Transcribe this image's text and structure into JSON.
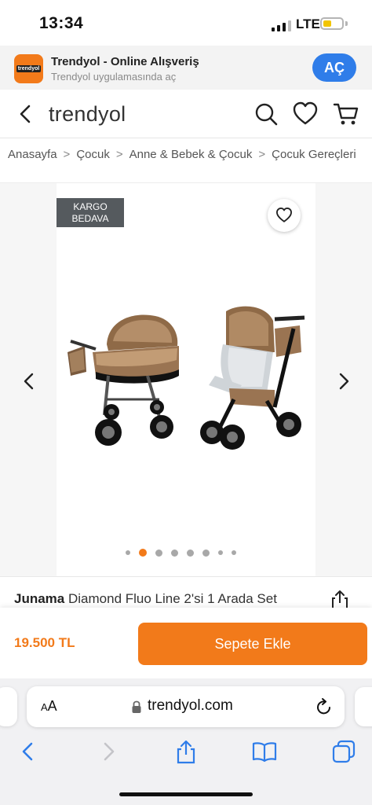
{
  "status_bar": {
    "time": "13:34",
    "network": "LTE"
  },
  "app_banner": {
    "logo_text": "trendyol",
    "title": "Trendyol - Online Alışveriş",
    "subtitle": "Trendyol uygulamasında aç",
    "open_label": "AÇ"
  },
  "header": {
    "brand": "trendyol",
    "icons": [
      "back-icon",
      "search-icon",
      "heart-icon",
      "cart-icon"
    ]
  },
  "breadcrumb": [
    "Anasayfa",
    "Çocuk",
    "Anne & Bebek & Çocuk",
    "Çocuk Gereçleri"
  ],
  "gallery": {
    "badge_line1": "KARGO",
    "badge_line2": "BEDAVA",
    "image_count": 8,
    "active_index": 1
  },
  "product": {
    "brand": "Junama",
    "name": "Diamond Fluo Line 2'si 1 Arada Set"
  },
  "buy_bar": {
    "price": "19.500 TL",
    "add_to_cart_label": "Sepete Ekle"
  },
  "safari": {
    "aa_label": "AA",
    "url": "trendyol.com"
  },
  "colors": {
    "accent": "#f27a1a",
    "banner_button": "#2f7de9",
    "ios_blue": "#2f7de9"
  }
}
